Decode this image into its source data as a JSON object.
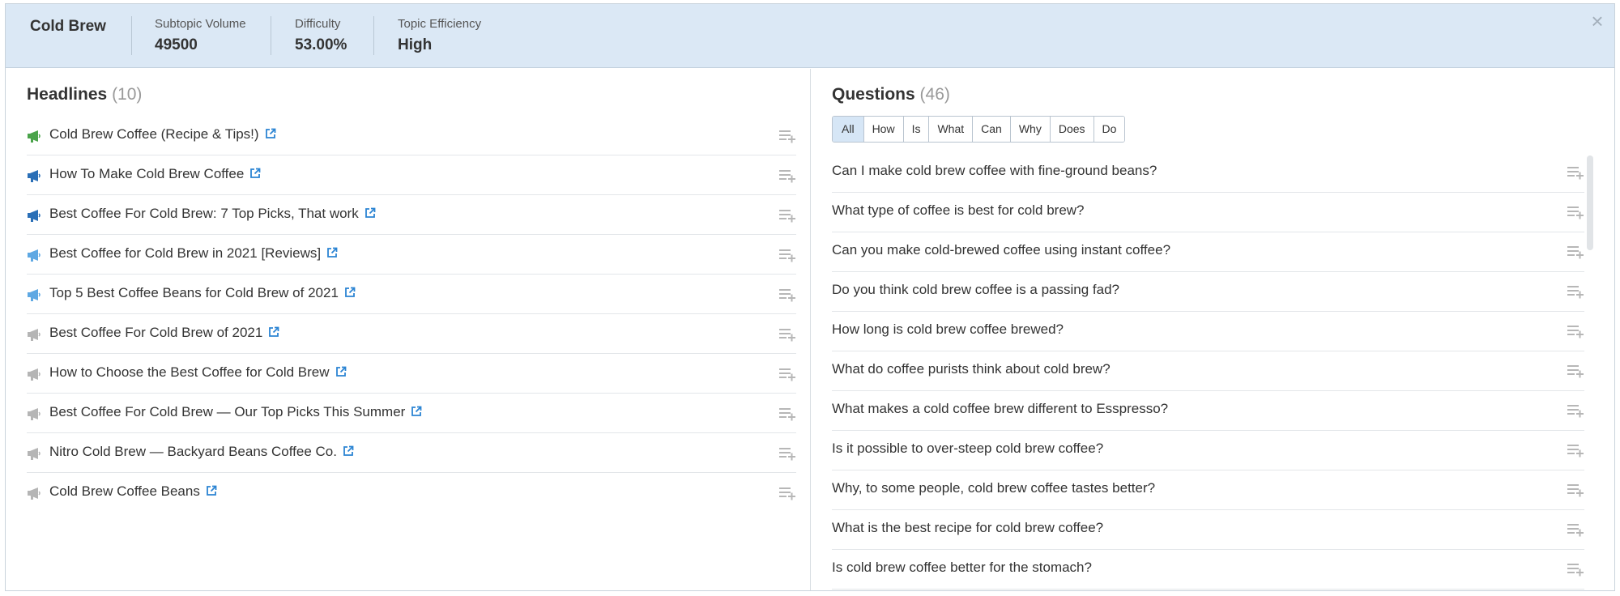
{
  "header": {
    "topic": "Cold Brew",
    "metrics": [
      {
        "label": "Subtopic Volume",
        "value": "49500"
      },
      {
        "label": "Difficulty",
        "value": "53.00%"
      },
      {
        "label": "Topic Efficiency",
        "value": "High"
      }
    ],
    "close_glyph": "×"
  },
  "headlines": {
    "title": "Headlines",
    "count": "(10)",
    "items": [
      {
        "text": "Cold Brew Coffee (Recipe & Tips!)",
        "icon": "megaphone-green-icon"
      },
      {
        "text": "How To Make Cold Brew Coffee",
        "icon": "megaphone-blue-icon"
      },
      {
        "text": "Best Coffee For Cold Brew: 7 Top Picks, That work",
        "icon": "megaphone-blue-icon"
      },
      {
        "text": "Best Coffee for Cold Brew in 2021 [Reviews]",
        "icon": "megaphone-lightblue-icon"
      },
      {
        "text": "Top 5 Best Coffee Beans for Cold Brew of 2021",
        "icon": "megaphone-lightblue-icon"
      },
      {
        "text": "Best Coffee For Cold Brew of 2021",
        "icon": "megaphone-gray-icon"
      },
      {
        "text": "How to Choose the Best Coffee for Cold Brew",
        "icon": "megaphone-gray-icon"
      },
      {
        "text": "Best Coffee For Cold Brew — Our Top Picks This Summer",
        "icon": "megaphone-gray-icon"
      },
      {
        "text": "Nitro Cold Brew — Backyard Beans Coffee Co.",
        "icon": "megaphone-gray-icon"
      },
      {
        "text": "Cold Brew Coffee Beans",
        "icon": "megaphone-gray-icon"
      }
    ]
  },
  "questions": {
    "title": "Questions",
    "count": "(46)",
    "filters": [
      "All",
      "How",
      "Is",
      "What",
      "Can",
      "Why",
      "Does",
      "Do"
    ],
    "active_filter": "All",
    "items": [
      "Can I make cold brew coffee with fine-ground beans?",
      "What type of coffee is best for cold brew?",
      "Can you make cold-brewed coffee using instant coffee?",
      "Do you think cold brew coffee is a passing fad?",
      "How long is cold brew coffee brewed?",
      "What do coffee purists think about cold brew?",
      "What makes a cold coffee brew different to Esspresso?",
      "Is it possible to over-steep cold brew coffee?",
      "Why, to some people, cold brew coffee tastes better?",
      "What is the best recipe for cold brew coffee?",
      "Is cold brew coffee better for the stomach?"
    ]
  },
  "colors": {
    "header_bg": "#dbe8f5",
    "link_blue": "#2b84d3",
    "megaphone_green": "#4aa34a",
    "megaphone_blue": "#2a6fb7",
    "megaphone_lightblue": "#5ea8e3",
    "megaphone_gray": "#b5b5b5"
  }
}
